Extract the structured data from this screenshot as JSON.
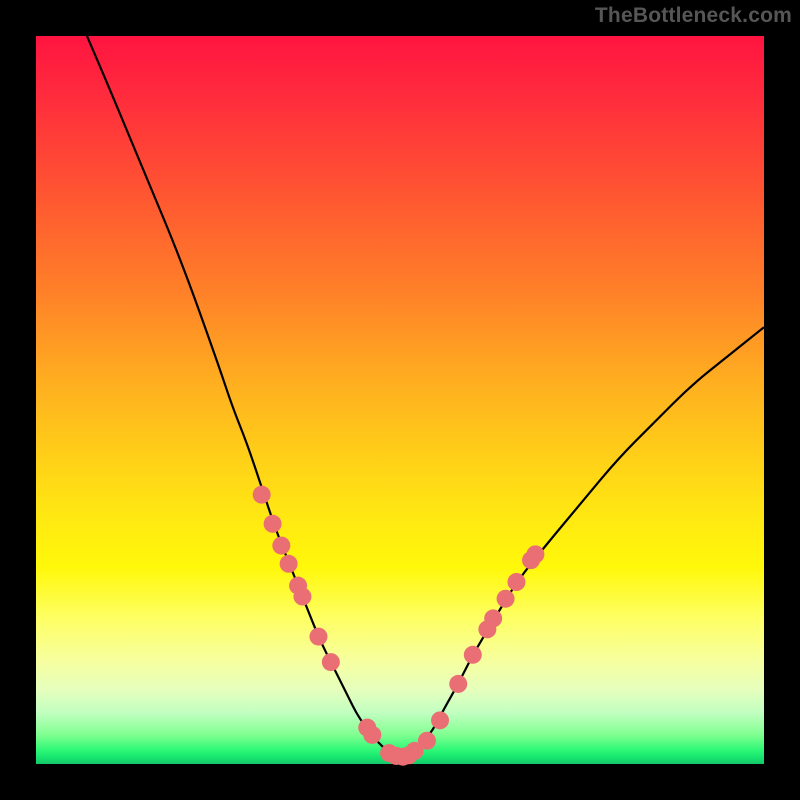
{
  "watermark": "TheBottleneck.com",
  "chart_data": {
    "type": "line",
    "title": "",
    "xlabel": "",
    "ylabel": "",
    "xlim": [
      0,
      100
    ],
    "ylim": [
      0,
      100
    ],
    "grid": false,
    "annotations": [
      "TheBottleneck.com"
    ],
    "series": [
      {
        "name": "bottleneck-curve",
        "x": [
          7,
          10,
          15,
          20,
          25,
          27,
          29,
          31,
          33,
          35,
          37,
          39,
          41,
          43,
          44,
          45,
          46,
          47,
          48,
          49,
          50,
          51,
          52,
          53,
          54,
          55,
          56,
          58,
          60,
          63,
          66,
          70,
          75,
          80,
          85,
          90,
          95,
          100
        ],
        "y": [
          100,
          93,
          81,
          69,
          55,
          49,
          44,
          38,
          32,
          27,
          22,
          17,
          13,
          9,
          7,
          5.5,
          4,
          3,
          2,
          1.3,
          1,
          1.2,
          1.8,
          2.8,
          4,
          5.5,
          7.5,
          11,
          15,
          20,
          25,
          30,
          36,
          42,
          47,
          52,
          56,
          60
        ]
      }
    ],
    "markers": {
      "name": "sample-points",
      "color": "#e96f75",
      "points": [
        {
          "x": 31.0,
          "y": 37
        },
        {
          "x": 32.5,
          "y": 33
        },
        {
          "x": 33.7,
          "y": 30
        },
        {
          "x": 34.7,
          "y": 27.5
        },
        {
          "x": 36.0,
          "y": 24.5
        },
        {
          "x": 36.6,
          "y": 23
        },
        {
          "x": 38.8,
          "y": 17.5
        },
        {
          "x": 40.5,
          "y": 14
        },
        {
          "x": 45.5,
          "y": 5
        },
        {
          "x": 46.2,
          "y": 4
        },
        {
          "x": 48.5,
          "y": 1.5
        },
        {
          "x": 49.5,
          "y": 1.1
        },
        {
          "x": 50.4,
          "y": 1.0
        },
        {
          "x": 51.2,
          "y": 1.2
        },
        {
          "x": 52.0,
          "y": 1.8
        },
        {
          "x": 53.7,
          "y": 3.2
        },
        {
          "x": 55.5,
          "y": 6.0
        },
        {
          "x": 58.0,
          "y": 11.0
        },
        {
          "x": 60.0,
          "y": 15.0
        },
        {
          "x": 62.0,
          "y": 18.5
        },
        {
          "x": 62.8,
          "y": 20.0
        },
        {
          "x": 64.5,
          "y": 22.7
        },
        {
          "x": 66.0,
          "y": 25.0
        },
        {
          "x": 68.0,
          "y": 28.0
        },
        {
          "x": 68.6,
          "y": 28.8
        }
      ]
    }
  }
}
